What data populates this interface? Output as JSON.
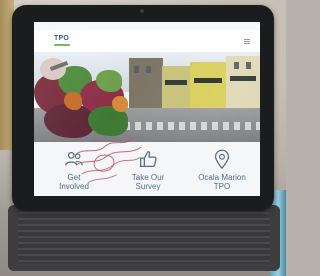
{
  "photo": {
    "subject": "tablet-on-stand",
    "colors": {
      "site_blue": "#1d4e8f",
      "site_green": "#6bb844",
      "tile_text": "#4d6a86",
      "marker": "#b9465e"
    }
  },
  "site": {
    "logo_text": "TPO",
    "tiles": [
      {
        "icon": "people-icon",
        "label_lines": [
          "Get",
          "Involved"
        ]
      },
      {
        "icon": "thumbs-up-icon",
        "label_lines": [
          "Take Our",
          "Survey"
        ]
      },
      {
        "icon": "map-pin-icon",
        "label_lines": [
          "Ocala Marion",
          "TPO"
        ]
      }
    ]
  }
}
